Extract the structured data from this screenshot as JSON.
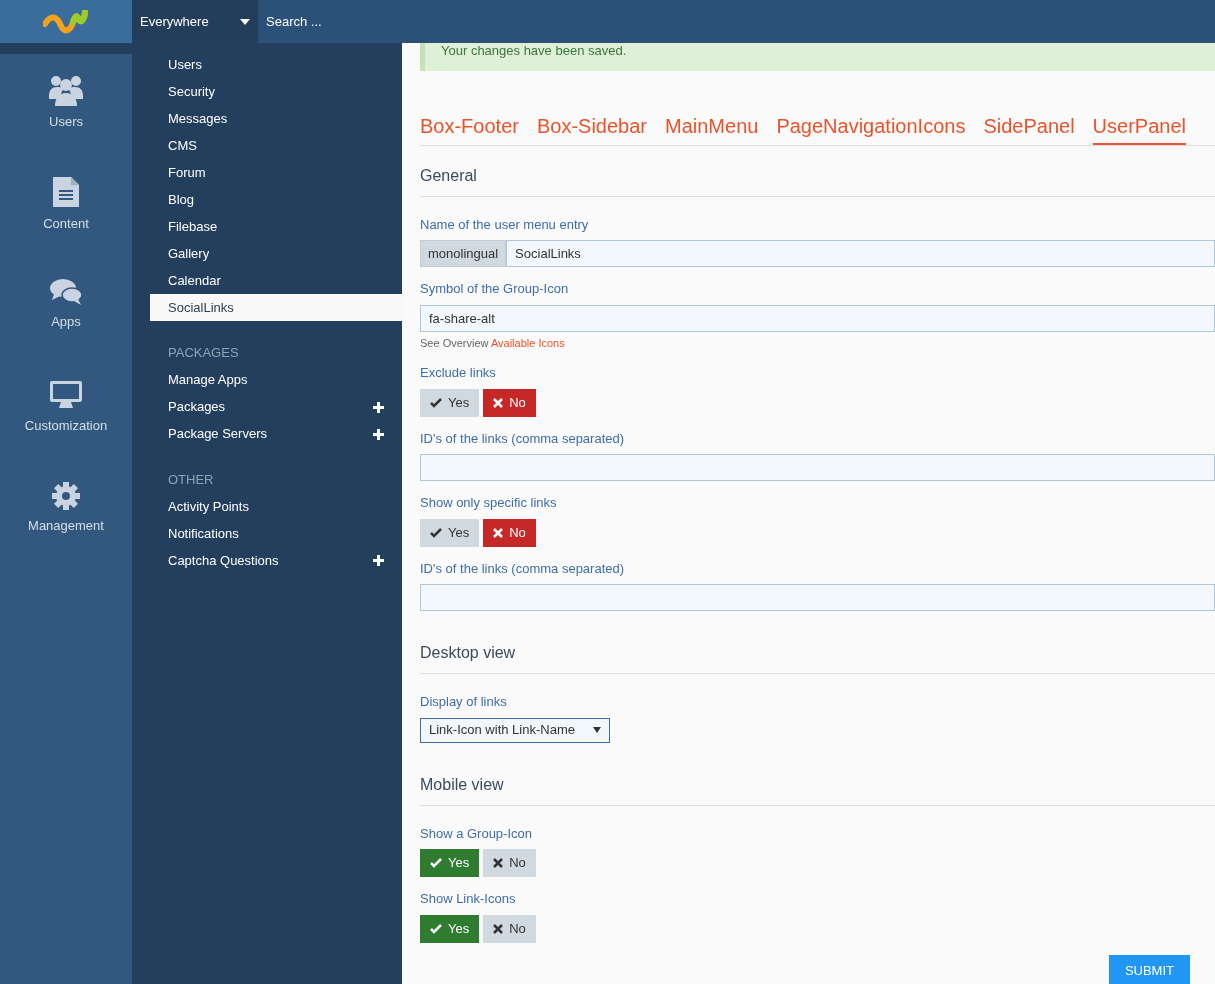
{
  "topbar": {
    "search_scope": "Everywhere",
    "search_placeholder": "Search ..."
  },
  "main_menu": [
    {
      "label": "Users",
      "kind": "users"
    },
    {
      "label": "Content",
      "kind": "content"
    },
    {
      "label": "Apps",
      "kind": "apps"
    },
    {
      "label": "Customization",
      "kind": "customization"
    },
    {
      "label": "Management",
      "kind": "management"
    }
  ],
  "sub_menu": [
    {
      "items": [
        {
          "label": "Users",
          "selected": false,
          "expandable": false
        },
        {
          "label": "Security",
          "selected": false,
          "expandable": false
        },
        {
          "label": "Messages",
          "selected": false,
          "expandable": false
        },
        {
          "label": "CMS",
          "selected": false,
          "expandable": false
        },
        {
          "label": "Forum",
          "selected": false,
          "expandable": false
        },
        {
          "label": "Blog",
          "selected": false,
          "expandable": false
        },
        {
          "label": "Filebase",
          "selected": false,
          "expandable": false
        },
        {
          "label": "Gallery",
          "selected": false,
          "expandable": false
        },
        {
          "label": "Calendar",
          "selected": false,
          "expandable": false
        },
        {
          "label": "SocialLinks",
          "selected": true,
          "expandable": false
        }
      ]
    },
    {
      "title": "PACKAGES",
      "items": [
        {
          "label": "Manage Apps",
          "selected": false,
          "expandable": false
        },
        {
          "label": "Packages",
          "selected": false,
          "expandable": true
        },
        {
          "label": "Package Servers",
          "selected": false,
          "expandable": true
        }
      ]
    },
    {
      "title": "OTHER",
      "items": [
        {
          "label": "Activity Points",
          "selected": false,
          "expandable": false
        },
        {
          "label": "Notifications",
          "selected": false,
          "expandable": false
        },
        {
          "label": "Captcha Questions",
          "selected": false,
          "expandable": true
        }
      ]
    }
  ],
  "success_message": "Your changes have been saved.",
  "tabs": [
    {
      "label": "Box-Footer",
      "selected": false
    },
    {
      "label": "Box-Sidebar",
      "selected": false
    },
    {
      "label": "MainMenu",
      "selected": false
    },
    {
      "label": "PageNavigationIcons",
      "selected": false
    },
    {
      "label": "SidePanel",
      "selected": false
    },
    {
      "label": "UserPanel",
      "selected": true
    }
  ],
  "sections": [
    {
      "title": "General",
      "fields": [
        {
          "kind": "text",
          "label": "Name of the user menu entry",
          "addon": "monolingual",
          "value": "SocialLinks"
        },
        {
          "kind": "text",
          "label": "Symbol of the Group-Icon",
          "value": "fa-share-alt",
          "help": "See Overview",
          "help_link": "Available Icons"
        },
        {
          "kind": "toggle",
          "label": "Exclude links",
          "options": [
            {
              "label": "Yes",
              "kind": "yes",
              "selected": false
            },
            {
              "label": "No",
              "kind": "no",
              "selected": true
            }
          ]
        },
        {
          "kind": "text",
          "label": "ID's of the links (comma separated)"
        },
        {
          "kind": "toggle",
          "label": "Show only specific links",
          "options": [
            {
              "label": "Yes",
              "kind": "yes",
              "selected": false
            },
            {
              "label": "No",
              "kind": "no",
              "selected": true
            }
          ]
        },
        {
          "kind": "text",
          "label": "ID's of the links (comma separated)"
        }
      ]
    },
    {
      "title": "Desktop view",
      "fields": [
        {
          "kind": "select",
          "label": "Display of links",
          "value": "Link-Icon with Link-Name"
        }
      ]
    },
    {
      "title": "Mobile view",
      "fields": [
        {
          "kind": "toggle",
          "label": "Show a Group-Icon",
          "options": [
            {
              "label": "Yes",
              "kind": "yes",
              "selected": true
            },
            {
              "label": "No",
              "kind": "no",
              "selected": false
            }
          ]
        },
        {
          "kind": "toggle",
          "label": "Show Link-Icons",
          "options": [
            {
              "label": "Yes",
              "kind": "yes",
              "selected": true
            },
            {
              "label": "No",
              "kind": "no",
              "selected": false
            }
          ]
        }
      ]
    }
  ],
  "submit": "SUBMIT"
}
